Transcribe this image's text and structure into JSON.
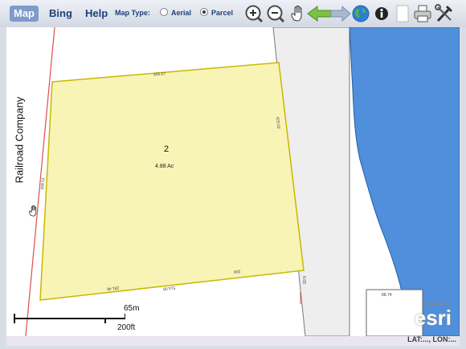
{
  "toolbar": {
    "tabs": [
      {
        "label": "Map",
        "active": true
      },
      {
        "label": "Bing",
        "active": false
      },
      {
        "label": "Help",
        "active": false
      }
    ],
    "map_type_label": "Map Type:",
    "map_type_options": [
      {
        "label": "Aerial",
        "selected": false
      },
      {
        "label": "Parcel",
        "selected": true
      }
    ],
    "tools": [
      "zoom-in-icon",
      "zoom-out-icon",
      "pan-hand-icon",
      "back-arrow-icon",
      "forward-arrow-icon",
      "globe-icon",
      "info-icon",
      "blank-page-icon",
      "print-icon",
      "tools-icon"
    ]
  },
  "map": {
    "railroad_label": "Railroad Company",
    "parcel_number": "2",
    "parcel_area": "4.88 Ac",
    "edge_labels": {
      "top": "450.07",
      "right": "423.02",
      "left": "458.01",
      "bottom_a": "514.08",
      "bottom_b": "281.46",
      "bottom_c": "208",
      "right_small": "6.00",
      "lower_lot": "88.74"
    },
    "scale": {
      "metric": "65m",
      "imperial": "200ft"
    },
    "attribution": {
      "small": "POWERED BY",
      "logo": "esri"
    },
    "colors": {
      "parcel_fill": "#f8f4b6",
      "parcel_edge": "#c9b700",
      "road": "#eeeeee",
      "water": "#4f8fdc",
      "rail_line": "#e04d4d"
    }
  },
  "status": {
    "latlon": "LAT:..., LON:..."
  }
}
